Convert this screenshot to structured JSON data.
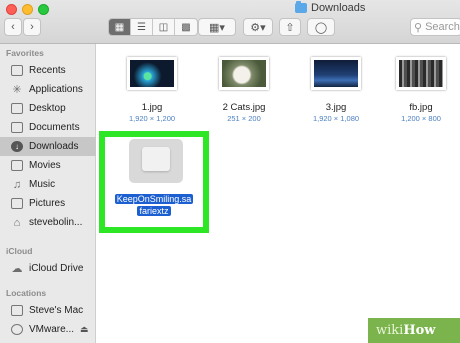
{
  "window": {
    "title": "Downloads",
    "search_placeholder": "Search"
  },
  "toolbar": {
    "back_icon": "chevron-left-icon",
    "forward_icon": "chevron-right-icon",
    "view_modes": [
      "icon",
      "list",
      "column",
      "gallery"
    ],
    "active_view": "icon"
  },
  "sidebar": {
    "favorites_header": "Favorites",
    "favorites": [
      {
        "label": "Recents",
        "icon": "clock-icon"
      },
      {
        "label": "Applications",
        "icon": "applications-icon"
      },
      {
        "label": "Desktop",
        "icon": "desktop-icon"
      },
      {
        "label": "Documents",
        "icon": "document-icon"
      },
      {
        "label": "Downloads",
        "icon": "download-icon",
        "selected": true
      },
      {
        "label": "Movies",
        "icon": "film-icon"
      },
      {
        "label": "Music",
        "icon": "music-icon"
      },
      {
        "label": "Pictures",
        "icon": "camera-icon"
      },
      {
        "label": "stevebolin...",
        "icon": "home-icon"
      }
    ],
    "icloud_header": "iCloud",
    "icloud": [
      {
        "label": "iCloud Drive",
        "icon": "cloud-icon"
      }
    ],
    "locations_header": "Locations",
    "locations": [
      {
        "label": "Steve's Mac",
        "icon": "laptop-icon"
      },
      {
        "label": "VMware...",
        "icon": "disk-icon"
      }
    ]
  },
  "files": [
    {
      "name": "1.jpg",
      "size": "1,920 × 1,200"
    },
    {
      "name": "2 Cats.jpg",
      "size": "251 × 200"
    },
    {
      "name": "3.jpg",
      "size": "1,920 × 1,080"
    },
    {
      "name": "fb.jpg",
      "size": "1,200 × 800"
    }
  ],
  "selected_file": {
    "name_line1": "KeepOnSmiling.sa",
    "name_line2": "fariextz",
    "highlight_color": "#2de626"
  },
  "watermark": {
    "part1": "wiki",
    "part2": "How"
  }
}
